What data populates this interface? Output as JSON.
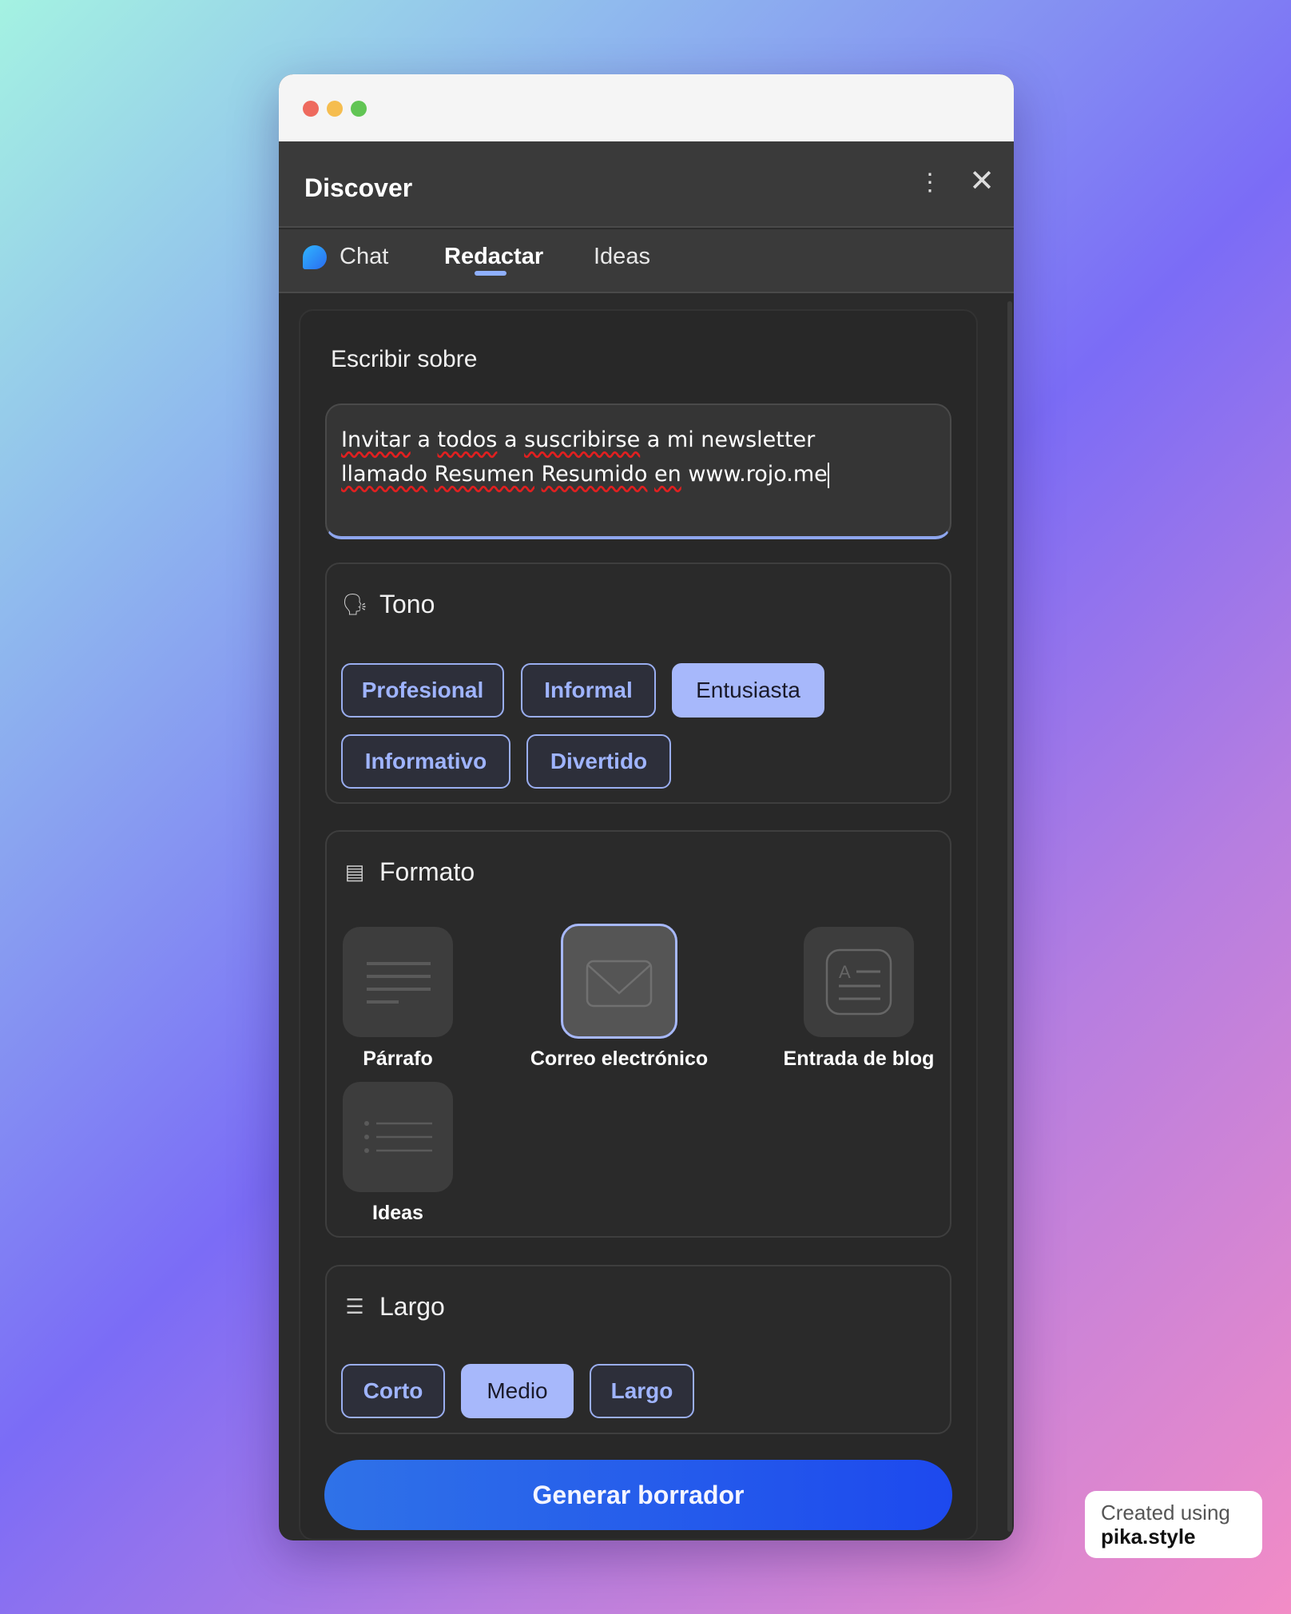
{
  "window": {
    "title": "Discover",
    "more_icon": "more-vertical-icon",
    "close_icon": "close-icon"
  },
  "tabs": [
    {
      "label": "Chat",
      "icon": "chat-bubble-icon"
    },
    {
      "label": "Redactar",
      "active": true
    },
    {
      "label": "Ideas"
    }
  ],
  "compose": {
    "topic_label": "Escribir sobre",
    "topic_value_parts": [
      "Invitar",
      " a ",
      "todos",
      " a ",
      "suscribirse",
      " a mi newsletter\n",
      "llamado",
      " ",
      "Resumen",
      " ",
      "Resumido",
      " ",
      "en",
      " www.rojo.me"
    ],
    "tone": {
      "title": "Tono",
      "options": [
        "Profesional",
        "Informal",
        "Entusiasta",
        "Informativo",
        "Divertido"
      ],
      "selected": "Entusiasta"
    },
    "format": {
      "title": "Formato",
      "options": [
        "Párrafo",
        "Correo electrónico",
        "Entrada de blog",
        "Ideas"
      ],
      "selected": "Correo electrónico"
    },
    "length": {
      "title": "Largo",
      "options": [
        "Corto",
        "Medio",
        "Largo"
      ],
      "selected": "Medio"
    },
    "generate_label": "Generar borrador"
  },
  "badge": {
    "line1": "Created using",
    "line2": "pika.style"
  },
  "colors": {
    "accent": "#a7b8fb",
    "button": "#1d49ee",
    "panel": "#2b2b2b"
  }
}
